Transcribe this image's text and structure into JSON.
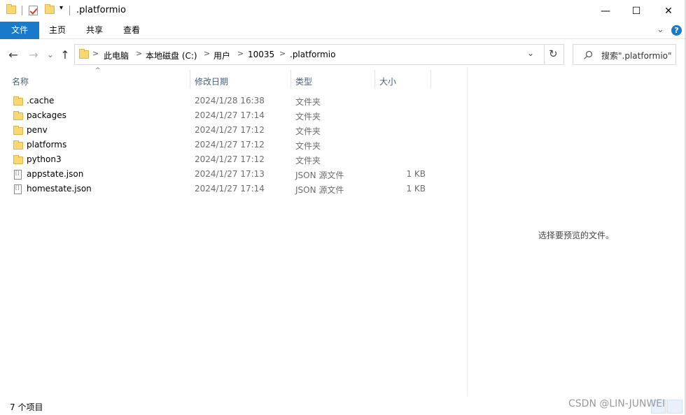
{
  "window": {
    "title": ".platformio",
    "minimize_glyph": "—",
    "maximize_glyph": "☐",
    "close_glyph": "✕"
  },
  "ribbon": {
    "tabs": [
      "文件",
      "主页",
      "共享",
      "查看"
    ],
    "expand_glyph": "⌄",
    "help_glyph": "?"
  },
  "nav": {
    "back_glyph": "←",
    "forward_glyph": "→",
    "recent_glyph": "⌄",
    "up_glyph": "↑",
    "refresh_glyph": "↻",
    "dropdown_glyph": "⌄"
  },
  "address": {
    "crumbs": [
      "此电脑",
      "本地磁盘 (C:)",
      "用户",
      "10035",
      ".platformio"
    ],
    "separator": ">"
  },
  "search": {
    "placeholder": "搜索\".platformio\"",
    "icon": "search-icon"
  },
  "columns": {
    "name": "名称",
    "date": "修改日期",
    "type": "类型",
    "size": "大小",
    "sort_glyph": "^"
  },
  "files": [
    {
      "name": ".cache",
      "date": "2024/1/28 16:38",
      "type": "文件夹",
      "size": "",
      "kind": "folder"
    },
    {
      "name": "packages",
      "date": "2024/1/27 17:14",
      "type": "文件夹",
      "size": "",
      "kind": "folder"
    },
    {
      "name": "penv",
      "date": "2024/1/27 17:12",
      "type": "文件夹",
      "size": "",
      "kind": "folder"
    },
    {
      "name": "platforms",
      "date": "2024/1/27 17:12",
      "type": "文件夹",
      "size": "",
      "kind": "folder"
    },
    {
      "name": "python3",
      "date": "2024/1/27 17:12",
      "type": "文件夹",
      "size": "",
      "kind": "folder"
    },
    {
      "name": "appstate.json",
      "date": "2024/1/27 17:13",
      "type": "JSON 源文件",
      "size": "1 KB",
      "kind": "file"
    },
    {
      "name": "homestate.json",
      "date": "2024/1/27 17:14",
      "type": "JSON 源文件",
      "size": "1 KB",
      "kind": "file"
    }
  ],
  "preview": {
    "message": "选择要预览的文件。"
  },
  "status": {
    "item_count": "7 个项目"
  },
  "watermark": "CSDN @LIN-JUNWEI",
  "colors": {
    "accent": "#1979ca",
    "folder": "#f8d775",
    "header_text": "#4c607a"
  }
}
